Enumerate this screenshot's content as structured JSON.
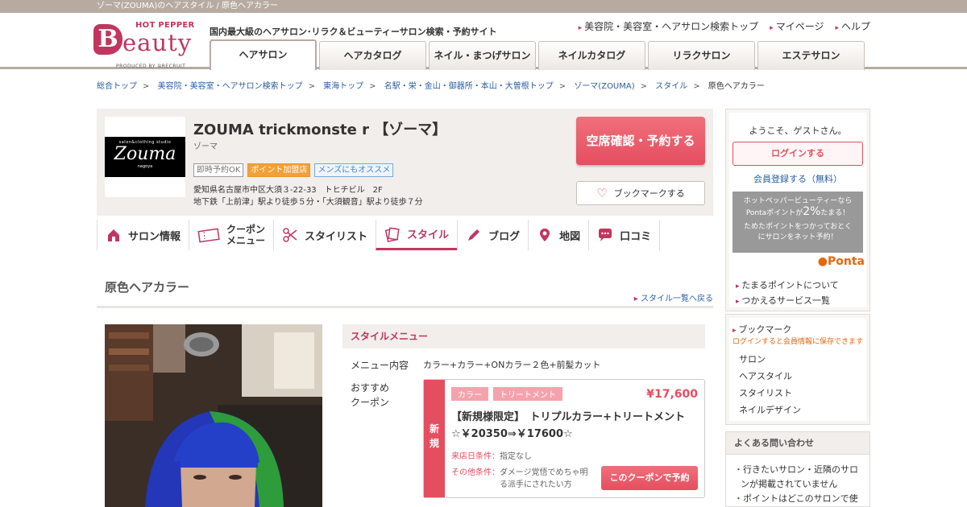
{
  "page_title_bar": "ゾーマ(ZOUMA)のヘアスタイル / 原色ヘアカラー",
  "brand": {
    "top": "HOT PEPPER",
    "b": "B",
    "rest": "eauty",
    "produced": "PRODUCED BY ℝRECRUIT"
  },
  "tagline": "国内最大級のヘアサロン･リラク＆ビューティーサロン検索・予約サイト",
  "top_links": [
    "美容院・美容室・ヘアサロン検索トップ",
    "マイページ",
    "ヘルプ"
  ],
  "global_nav": [
    "ヘアサロン",
    "ヘアカタログ",
    "ネイル・まつげサロン",
    "ネイルカタログ",
    "リラクサロン",
    "エステサロン"
  ],
  "breadcrumb": [
    "総合トップ",
    "美容院・美容室・ヘアサロン検索トップ",
    "東海トップ",
    "名駅・栄・金山・御器所・本山・大曽根トップ",
    "ゾーマ(ZOUMA)",
    "スタイル",
    "原色ヘアカラー"
  ],
  "salon": {
    "logo_small": "salon&clothing studio",
    "logo_name": "Zouma",
    "logo_sub": "nagoya",
    "name": "ZOUMA  trickmonste r 【ゾーマ】",
    "kana": "ゾーマ",
    "badges": [
      "即時予約OK",
      "ポイント加盟店",
      "メンズにもオススメ"
    ],
    "address": "愛知県名古屋市中区大須３-22-33　トヒチビル　2F",
    "access": "地下鉄「上前津」駅より徒歩５分・「大須観音」駅より徒歩７分",
    "reserve_label": "空席確認・予約する",
    "bookmark_label": "ブックマークする"
  },
  "salon_nav": {
    "info": "サロン情報",
    "coupon_1": "クーポン",
    "coupon_2": "メニュー",
    "stylist": "スタイリスト",
    "style": "スタイル",
    "blog": "ブログ",
    "map": "地図",
    "review": "口コミ"
  },
  "style_title": "原色ヘアカラー",
  "back_link": "スタイル一覧へ戻る",
  "menu": {
    "header": "スタイルメニュー",
    "content_label": "メニュー内容",
    "content_value": "カラー+カラー+ONカラー２色+前髪カット",
    "coupon_label_1": "おすすめ",
    "coupon_label_2": "クーポン"
  },
  "coupon": {
    "side_1": "新",
    "side_2": "規",
    "tags": [
      "カラー",
      "トリートメント"
    ],
    "price": "¥17,600",
    "title": "【新規様限定】　トリプルカラー+トリートメント　☆￥20350⇒￥17600☆",
    "cond1_key": "来店日条件：",
    "cond1_val": "指定なし",
    "cond2_key": "その他条件：",
    "cond2_val_1": "ダメージ覚悟でめちゃ明",
    "cond2_val_2": "る派手にされたい方",
    "button": "このクーポンで予約"
  },
  "sidebar": {
    "welcome": "ようこそ、ゲストさん。",
    "login": "ログインする",
    "register": "会員登録する（無料）",
    "ponta_1": "ホットペッパービューティーなら",
    "ponta_2a": "Pontaポイントが",
    "ponta_2b": "2%",
    "ponta_2c": "たまる！",
    "ponta_3": "ためたポイントをつかっておとく",
    "ponta_4": "にサロンをネット予約！",
    "ponta_logo": "Ponta",
    "links": [
      "たまるポイントについて",
      "つかえるサービス一覧"
    ],
    "bookmark_title": "ブックマーク",
    "bookmark_note": "ログインすると会員情報に保存できます",
    "bookmark_items": [
      "サロン",
      "ヘアスタイル",
      "スタイリスト",
      "ネイルデザイン"
    ],
    "faq_title": "よくある問い合わせ",
    "faq_1": "行きたいサロン・近隣のサロンが掲載されていません",
    "faq_2": "ポイントはどこのサロンで使"
  },
  "colors": {
    "brand": "#c1365f",
    "accent": "#e54e5f",
    "link": "#2c5e9e"
  }
}
